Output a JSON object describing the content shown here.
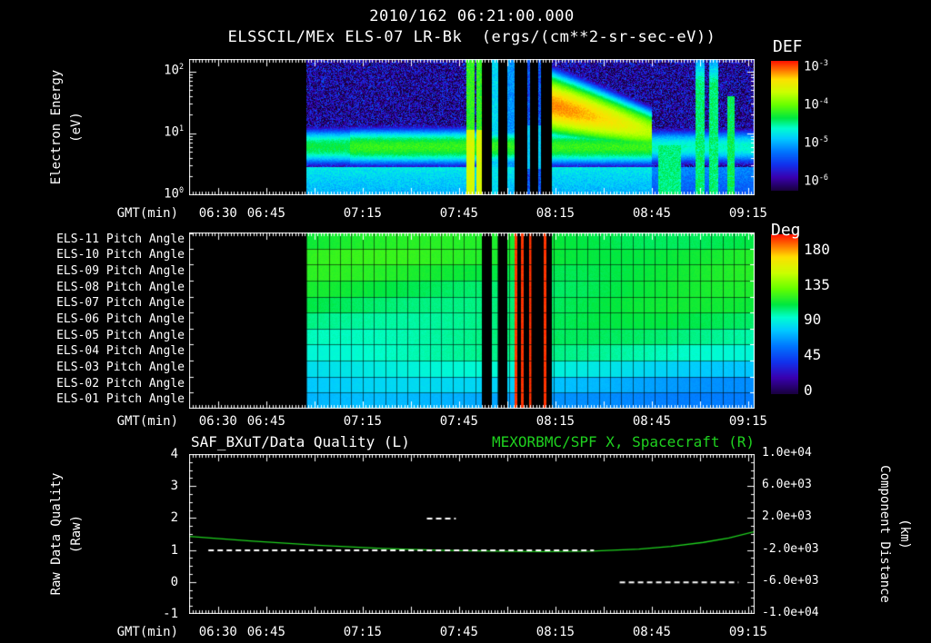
{
  "header": {
    "timestamp": "2010/162 06:21:00.000",
    "instrument_title": "ELSSCIL/MEx ELS-07 LR-Bk",
    "units": "(ergs/(cm**2-sr-sec-eV))"
  },
  "time_axis": {
    "label": "GMT(min)",
    "start_time": "06:21",
    "range_min": [
      0,
      176
    ],
    "major_ticks": [
      {
        "min": 9,
        "label": "06:30"
      },
      {
        "min": 24,
        "label": "06:45"
      },
      {
        "min": 54,
        "label": "07:15"
      },
      {
        "min": 84,
        "label": "07:45"
      },
      {
        "min": 114,
        "label": "08:15"
      },
      {
        "min": 144,
        "label": "08:45"
      },
      {
        "min": 174,
        "label": "09:15"
      }
    ],
    "unlabeled_major_min": [
      39,
      69,
      99,
      129,
      159
    ],
    "minor_step_min": 1
  },
  "colormap_stops": [
    [
      0.0,
      "#1a0040"
    ],
    [
      0.1,
      "#3a00b0"
    ],
    [
      0.2,
      "#1133ee"
    ],
    [
      0.3,
      "#0077ff"
    ],
    [
      0.4,
      "#00ccff"
    ],
    [
      0.48,
      "#00ffd0"
    ],
    [
      0.56,
      "#00e840"
    ],
    [
      0.66,
      "#66ff00"
    ],
    [
      0.76,
      "#ccff00"
    ],
    [
      0.86,
      "#ffe000"
    ],
    [
      0.93,
      "#ff7700"
    ],
    [
      1.0,
      "#ff1500"
    ]
  ],
  "chart_data": [
    {
      "id": "electron-energy-spectrogram",
      "type": "heatmap",
      "ylabel_lines": [
        "Electron Energy",
        "(eV)"
      ],
      "yscale": "log10",
      "ylim_log10": [
        0,
        2.2
      ],
      "ytick_exponents": [
        2,
        1,
        0
      ],
      "colorbar": {
        "title": "DEF",
        "tick_exponents": [
          -3,
          -4,
          -5,
          -6
        ],
        "range_log10": [
          -6,
          -3
        ]
      },
      "data_start_min": 36.5,
      "features": {
        "background_log10": [
          -6.25,
          -5.3
        ],
        "low_energy": {
          "below_log10_eV": 0.45,
          "value_log10": -4.8
        },
        "band": {
          "center_log10_eV": 0.78,
          "halfwidth_log10": 0.3,
          "value_log10": -4.25,
          "dim_after_min": 144
        },
        "gaps_min": [
          [
            91.1,
            94.2
          ],
          [
            96.2,
            99.0
          ],
          [
            101.3,
            112.9
          ]
        ],
        "gap_thin_columns_min": [
          [
            105.2,
            106.0
          ],
          [
            108.6,
            109.4
          ]
        ],
        "burst_min": [
          86.3,
          91.1
        ],
        "mid_bright_min": [
          94.2,
          96.2
        ],
        "pre_gap_col_min": [
          99.0,
          101.3
        ],
        "blob": {
          "t_min": [
            112.9,
            144.0
          ],
          "center_log10_eV": [
            1.45,
            1.03
          ],
          "halfwidth_log10": [
            0.45,
            0.32
          ],
          "peak_log10": -3.3
        },
        "low_energy_patch_min": [
          146,
          153
        ],
        "end_stripes_min": [
          [
            157.6,
            160.4
          ],
          [
            161.8,
            164.7
          ],
          [
            167.5,
            169.8
          ]
        ]
      }
    },
    {
      "id": "pitch-angle-panel",
      "type": "heatmap",
      "row_labels": [
        "ELS-11 Pitch Angle",
        "ELS-10 Pitch Angle",
        "ELS-09 Pitch Angle",
        "ELS-08 Pitch Angle",
        "ELS-07 Pitch Angle",
        "ELS-06 Pitch Angle",
        "ELS-05 Pitch Angle",
        "ELS-04 Pitch Angle",
        "ELS-03 Pitch Angle",
        "ELS-02 Pitch Angle",
        "ELS-01 Pitch Angle"
      ],
      "colorbar": {
        "title": "Deg",
        "ticks": [
          180,
          135,
          90,
          45,
          0
        ],
        "range": [
          0,
          180
        ]
      },
      "data_start_min": 36.5,
      "row_base_deg": [
        103,
        106,
        104,
        101,
        99,
        96,
        93,
        89,
        80,
        71,
        64
      ],
      "gaps_min": [
        [
          91.1,
          94.2
        ],
        [
          96.2,
          99.0
        ],
        [
          101.3,
          112.9
        ]
      ],
      "red_stripes_min": [
        [
          101.3,
          102.1
        ],
        [
          103.2,
          104.0
        ],
        [
          105.8,
          106.6
        ],
        [
          110.4,
          111.2
        ]
      ],
      "red_stripe_deg": 176,
      "grid_cell_min": 3.5
    },
    {
      "id": "quality-and-distance",
      "type": "line",
      "title_left": "SAF_BXuT/Data Quality (L)",
      "title_right": "MEXORBMC/SPF X, Spacecraft (R)",
      "title_right_color": "#1fd11f",
      "ylabel_left_lines": [
        "Raw Data Quality",
        "(Raw)"
      ],
      "ylabel_right_lines": [
        "Component Distance",
        "(km)"
      ],
      "ylim_left": [
        -1,
        4
      ],
      "yticks_left": [
        "4",
        "3",
        "2",
        "1",
        "0",
        "-1"
      ],
      "ylim_right": [
        -10000,
        10000
      ],
      "yticks_right": [
        "1.0e+04",
        "6.0e+03",
        "2.0e+03",
        "-2.0e+03",
        "-6.0e+03",
        "-1.0e+04"
      ],
      "series": [
        {
          "name": "raw-data-quality",
          "axis": "left",
          "color": "#ffffff",
          "style": "dashed",
          "segments": [
            {
              "y": 1,
              "t_min": [
                6,
                126
              ]
            },
            {
              "y": 2,
              "t_min": [
                74,
                83
              ]
            },
            {
              "y": 0,
              "t_min": [
                134,
                171
              ]
            }
          ]
        },
        {
          "name": "spacecraft-x-distance",
          "axis": "right",
          "color": "#1fd11f",
          "style": "solid",
          "points": [
            [
              0,
              -300
            ],
            [
              20,
              -900
            ],
            [
              40,
              -1400
            ],
            [
              60,
              -1800
            ],
            [
              80,
              -2050
            ],
            [
              95,
              -2150
            ],
            [
              110,
              -2200
            ],
            [
              125,
              -2150
            ],
            [
              140,
              -1900
            ],
            [
              150,
              -1550
            ],
            [
              160,
              -1050
            ],
            [
              168,
              -500
            ],
            [
              176,
              300
            ]
          ]
        }
      ]
    }
  ]
}
